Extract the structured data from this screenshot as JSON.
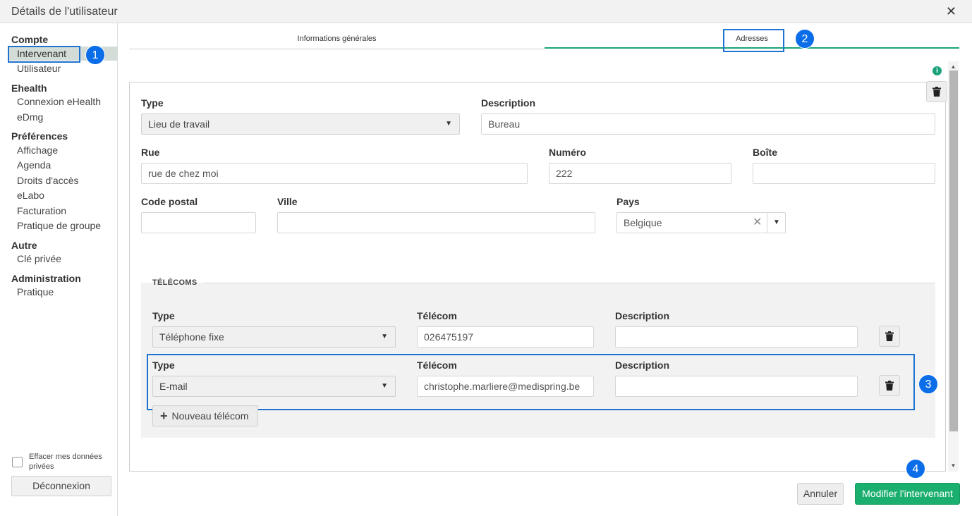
{
  "window": {
    "title": "Détails de l'utilisateur",
    "close": "✕"
  },
  "sidebar": {
    "groups": [
      {
        "title": "Compte",
        "items": [
          "Intervenant",
          "Utilisateur"
        ]
      },
      {
        "title": "Ehealth",
        "items": [
          "Connexion eHealth",
          "eDmg"
        ]
      },
      {
        "title": "Préférences",
        "items": [
          "Affichage",
          "Agenda",
          "Droits d'accès",
          "eLabo",
          "Facturation",
          "Pratique de groupe"
        ]
      },
      {
        "title": "Autre",
        "items": [
          "Clé privée"
        ]
      },
      {
        "title": "Administration",
        "items": [
          "Pratique"
        ]
      }
    ],
    "active_item": "Intervenant",
    "clear_data_label": "Effacer mes données privées",
    "clear_data_checked": false,
    "logout_label": "Déconnexion"
  },
  "tabs": [
    {
      "label": "Informations générales",
      "active": false
    },
    {
      "label": "Adresses",
      "active": true
    }
  ],
  "badges": [
    "1",
    "2",
    "3",
    "4"
  ],
  "address": {
    "type_label": "Type",
    "type_value": "Lieu de travail",
    "description_label": "Description",
    "description_value": "Bureau",
    "street_label": "Rue",
    "street_value": "rue de chez moi",
    "number_label": "Numéro",
    "number_value": "222",
    "box_label": "Boîte",
    "box_value": "",
    "postal_label": "Code postal",
    "postal_value": "",
    "city_label": "Ville",
    "city_value": "",
    "country_label": "Pays",
    "country_value": "Belgique"
  },
  "telecoms": {
    "legend": "TÉLÉCOMS",
    "rows": [
      {
        "type_label": "Type",
        "type_value": "Téléphone fixe",
        "telecom_label": "Télécom",
        "telecom_value": "026475197",
        "description_label": "Description",
        "description_value": ""
      },
      {
        "type_label": "Type",
        "type_value": "E-mail",
        "telecom_label": "Télécom",
        "telecom_value": "christophe.marliere@medispring.be",
        "description_label": "Description",
        "description_value": ""
      }
    ],
    "add_label": "Nouveau télécom"
  },
  "footer": {
    "cancel_label": "Annuler",
    "save_label": "Modifier l'intervenant"
  },
  "colors": {
    "accent": "#1aa37a",
    "primary_button": "#1aae6f",
    "highlight": "#1e73d2",
    "badge": "#0b6ee8"
  }
}
